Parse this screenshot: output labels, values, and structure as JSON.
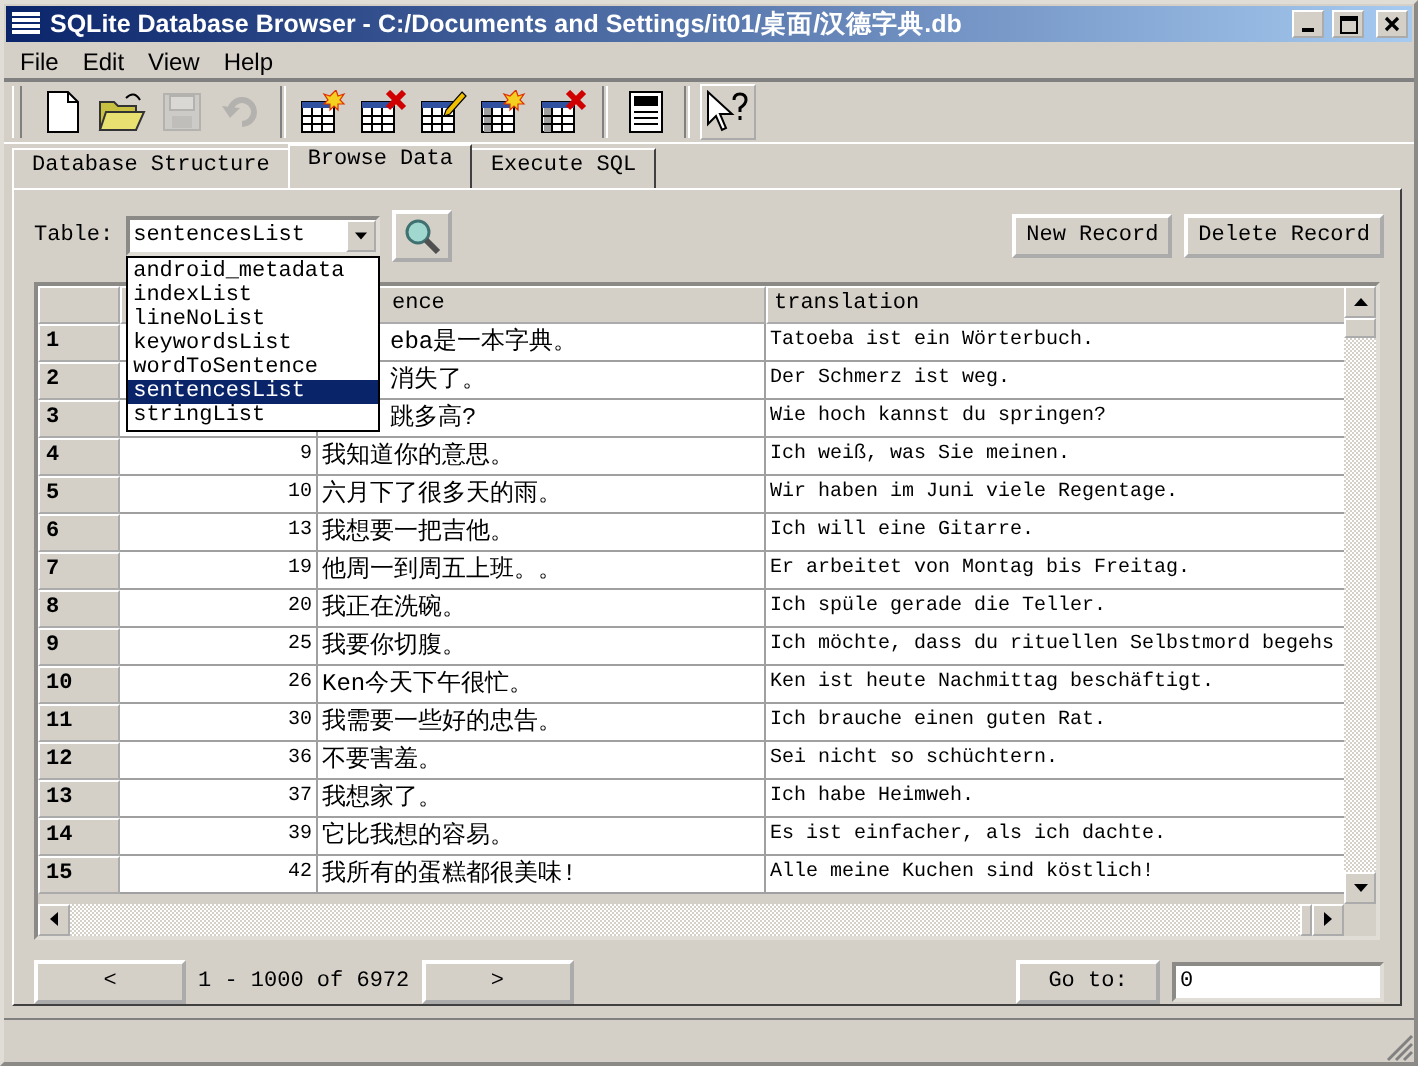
{
  "window": {
    "title": "SQLite Database Browser - C:/Documents and Settings/it01/桌面/汉德字典.db"
  },
  "menu": [
    "File",
    "Edit",
    "View",
    "Help"
  ],
  "toolbar": [
    {
      "kind": "new",
      "disabled": false
    },
    {
      "kind": "open",
      "disabled": false
    },
    {
      "kind": "save",
      "disabled": true
    },
    {
      "kind": "undo",
      "disabled": true
    },
    {
      "kind": "sep"
    },
    {
      "kind": "create-table",
      "disabled": false
    },
    {
      "kind": "delete-table",
      "disabled": false
    },
    {
      "kind": "edit-table",
      "disabled": false
    },
    {
      "kind": "create-index",
      "disabled": false
    },
    {
      "kind": "delete-index",
      "disabled": false
    },
    {
      "kind": "sep"
    },
    {
      "kind": "log",
      "disabled": false
    },
    {
      "kind": "sep"
    },
    {
      "kind": "whats-this",
      "disabled": false
    }
  ],
  "tabs": [
    {
      "label": "Database Structure",
      "selected": false
    },
    {
      "label": "Browse Data",
      "selected": true
    },
    {
      "label": "Execute SQL",
      "selected": false
    }
  ],
  "browse": {
    "table_label": "Table:",
    "table_value": "sentencesList",
    "table_options": [
      {
        "label": "android_metadata",
        "selected": false
      },
      {
        "label": "indexList",
        "selected": false
      },
      {
        "label": "lineNoList",
        "selected": false
      },
      {
        "label": "keywordsList",
        "selected": false
      },
      {
        "label": "wordToSentence",
        "selected": false
      },
      {
        "label": "sentencesList",
        "selected": true
      },
      {
        "label": "stringList",
        "selected": false
      }
    ],
    "buttons": [
      "New Record",
      "Delete Record"
    ]
  },
  "table": {
    "columns": [
      "ence",
      "translation"
    ],
    "rows": [
      {
        "header": "1",
        "sentence": "eba是一本字典。",
        "translation": "Tatoeba ist ein Wörterbuch."
      },
      {
        "header": "2",
        "sentence": "消失了。",
        "translation": "Der Schmerz ist weg."
      },
      {
        "header": "3",
        "sentence": "跳多高?",
        "translation": "Wie hoch kannst du springen?"
      },
      {
        "header": "4",
        "id": "9",
        "sentence": "我知道你的意思。",
        "translation": "Ich weiß, was Sie meinen."
      },
      {
        "header": "5",
        "id": "10",
        "sentence": "六月下了很多天的雨。",
        "translation": "Wir haben im Juni viele Regentage."
      },
      {
        "header": "6",
        "id": "13",
        "sentence": "我想要一把吉他。",
        "translation": "Ich will eine Gitarre."
      },
      {
        "header": "7",
        "id": "19",
        "sentence": "他周一到周五上班。。",
        "translation": "Er arbeitet von Montag bis Freitag."
      },
      {
        "header": "8",
        "id": "20",
        "sentence": "我正在洗碗。",
        "translation": "Ich spüle gerade die Teller."
      },
      {
        "header": "9",
        "id": "25",
        "sentence": "我要你切腹。",
        "translation": "Ich möchte, dass du rituellen Selbstmord begehs"
      },
      {
        "header": "10",
        "id": "26",
        "sentence": "Ken今天下午很忙。",
        "translation": "Ken ist heute Nachmittag beschäftigt."
      },
      {
        "header": "11",
        "id": "30",
        "sentence": "我需要一些好的忠告。",
        "translation": "Ich brauche einen guten Rat."
      },
      {
        "header": "12",
        "id": "36",
        "sentence": "不要害羞。",
        "translation": "Sei nicht so schüchtern."
      },
      {
        "header": "13",
        "id": "37",
        "sentence": "我想家了。",
        "translation": "Ich habe Heimweh."
      },
      {
        "header": "14",
        "id": "39",
        "sentence": "它比我想的容易。",
        "translation": "Es ist einfacher, als ich dachte."
      },
      {
        "header": "15",
        "id": "42",
        "sentence": "我所有的蛋糕都很美味!",
        "translation": "Alle meine Kuchen sind köstlich!"
      }
    ]
  },
  "pager": {
    "prev": "<",
    "range": "1 - 1000 of 6972",
    "next": ">",
    "goto_button": "Go to:",
    "goto_value": "0"
  }
}
